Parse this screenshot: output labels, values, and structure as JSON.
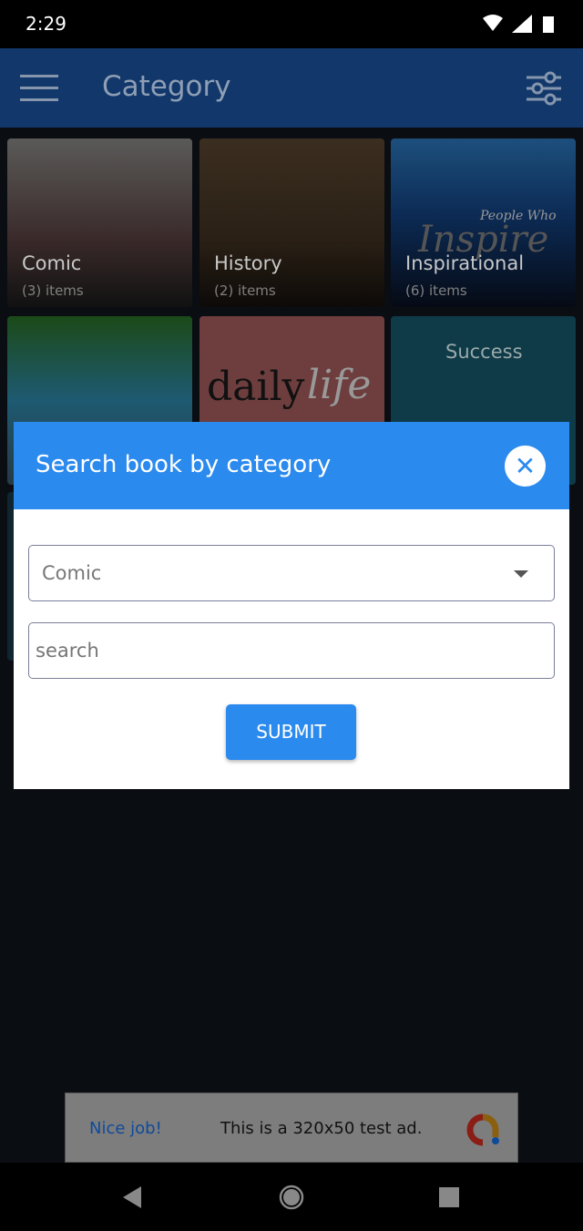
{
  "status": {
    "time": "2:29"
  },
  "appbar": {
    "title": "Category"
  },
  "categories": [
    {
      "name": "Comic",
      "count": "(3) items"
    },
    {
      "name": "History",
      "count": "(2) items"
    },
    {
      "name": "Inspirational",
      "count": "(6) items"
    },
    {
      "name": "",
      "count": ""
    },
    {
      "name": "",
      "count": ""
    },
    {
      "name": "",
      "count": ""
    }
  ],
  "tile_art": {
    "inspire_top": "People Who",
    "inspire_big": "Inspire",
    "daily": "daily",
    "life": "life",
    "success": "Success"
  },
  "modal": {
    "title": "Search book by category",
    "category_value": "Comic",
    "search_placeholder": "search",
    "submit": "SUBMIT"
  },
  "ad": {
    "left": "Nice job!",
    "text": "This is a 320x50 test ad."
  },
  "colors": {
    "accent": "#2b8aee",
    "appbar": "#1565c0"
  }
}
